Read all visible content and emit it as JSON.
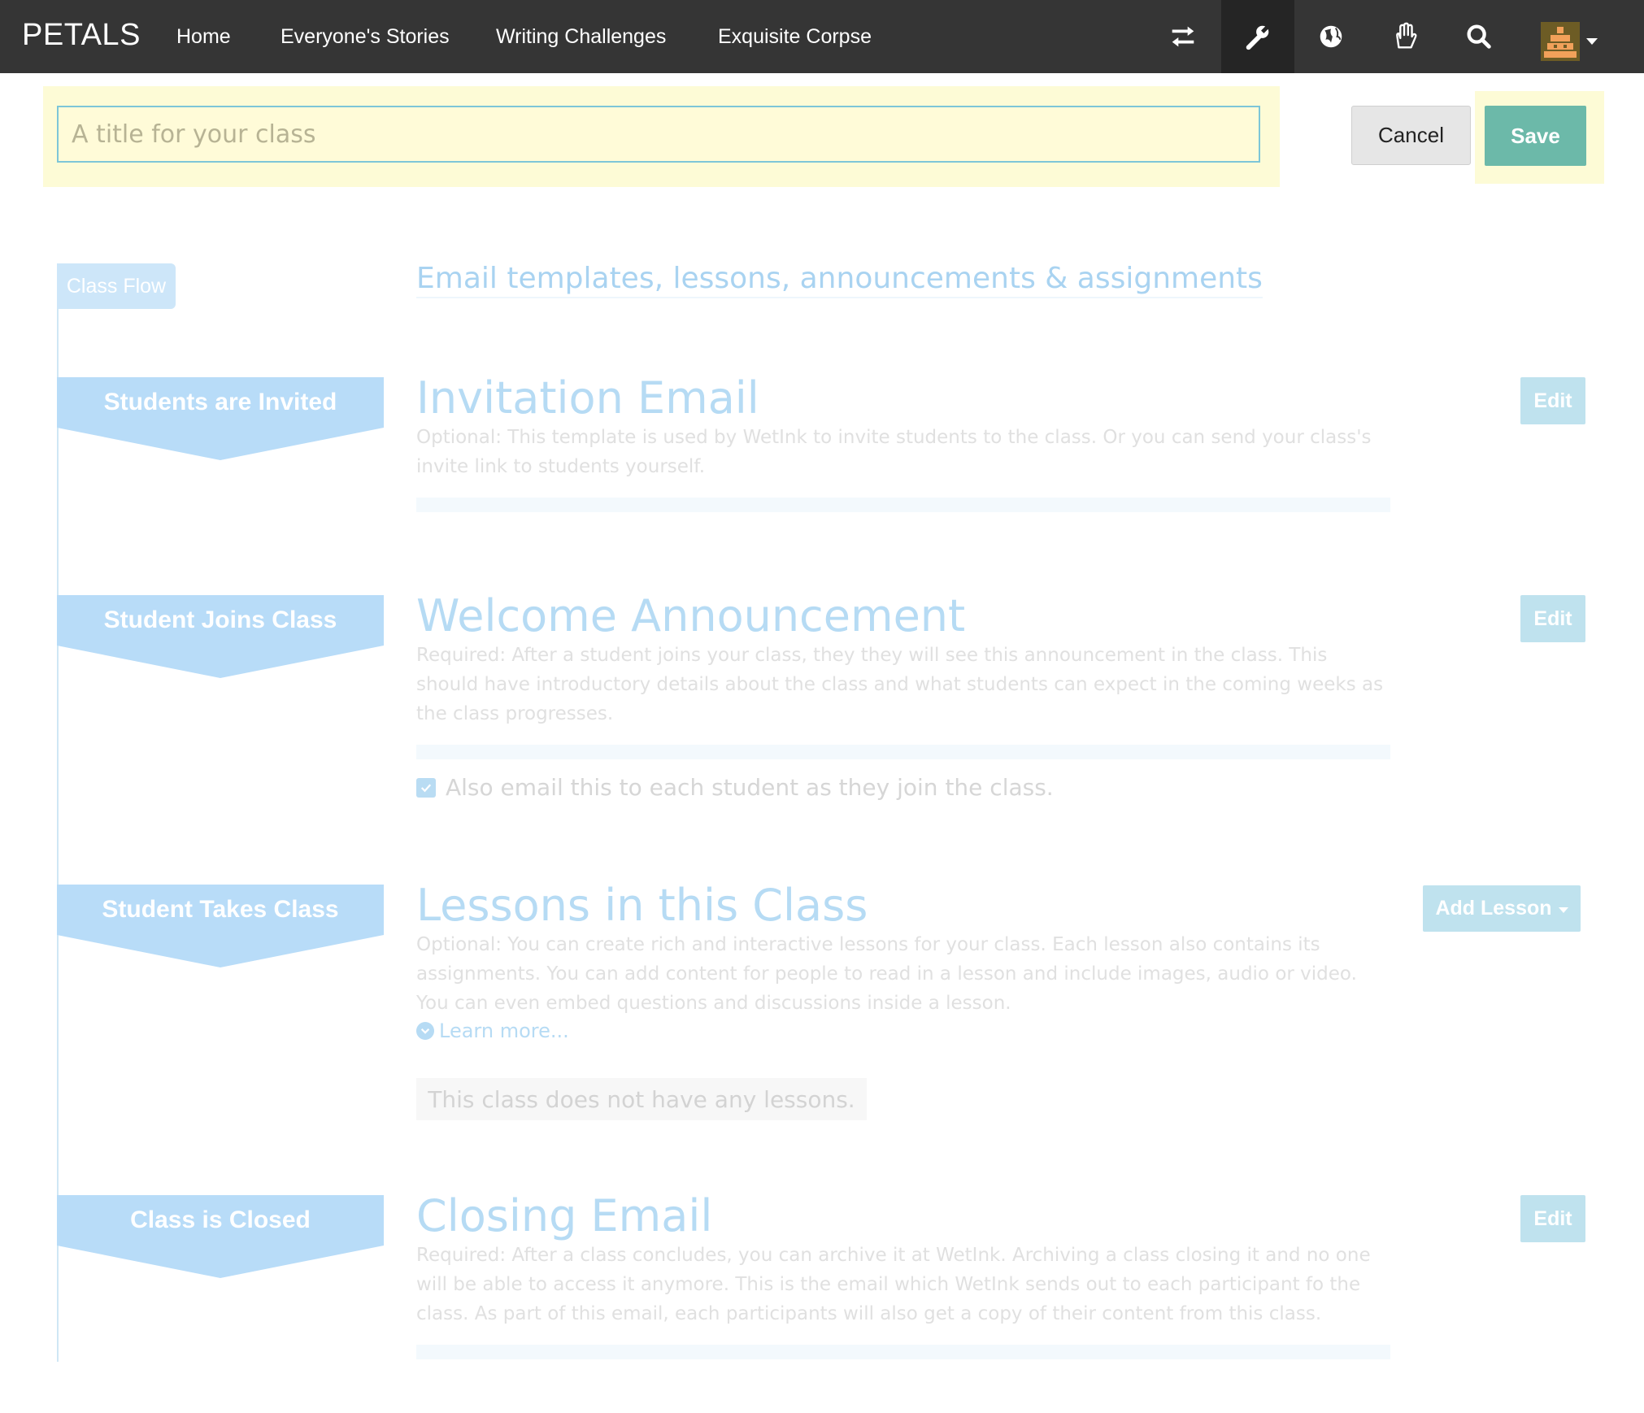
{
  "navbar": {
    "brand": "PETALS",
    "links": [
      "Home",
      "Everyone's Stories",
      "Writing Challenges",
      "Exquisite Corpse"
    ],
    "icons": [
      "transfer-icon",
      "wrench-icon",
      "globe-icon",
      "hand-icon",
      "search-icon",
      "avatar"
    ]
  },
  "title_bar": {
    "placeholder": "A title for your class",
    "value": "",
    "cancel_label": "Cancel",
    "save_label": "Save"
  },
  "flow": {
    "tab_label": "Class Flow",
    "subtitle": "Email templates, lessons, announcements & assignments",
    "stages": [
      {
        "label": "Students are Invited"
      },
      {
        "label": "Student Joins Class"
      },
      {
        "label": "Student Takes Class"
      },
      {
        "label": "Class is Closed"
      }
    ]
  },
  "sections": {
    "invitation": {
      "title": "Invitation Email",
      "description": "Optional: This template is used by WetInk to invite students to the class. Or you can send your class's invite link to students yourself.",
      "button": "Edit"
    },
    "welcome": {
      "title": "Welcome Announcement",
      "description": "Required: After a student joins your class, they they will see this announcement in the class. This should have introductory details about the class and what students can expect in the coming weeks as the class progresses.",
      "button": "Edit",
      "checkbox_label": "Also email this to each student as they join the class.",
      "checkbox_checked": true
    },
    "lessons": {
      "title": "Lessons in this Class",
      "description": "Optional: You can create rich and interactive lessons for your class. Each lesson also contains its assignments. You can add content for people to read in a lesson and include images, audio or video. You can even embed questions and discussions inside a lesson.",
      "learn_more": "Learn more...",
      "button": "Add Lesson",
      "empty_text": "This class does not have any lessons."
    },
    "closing": {
      "title": "Closing Email",
      "description": "Required: After a class concludes, you can archive it at WetInk. Archiving a class closing it and no one will be able to access it anymore. This is the email which WetInk sends out to each participant fo the class. As part of this email, each participants will also get a copy of their content from this class.",
      "button": "Edit"
    }
  },
  "colors": {
    "navbar_bg": "#353535",
    "highlight": "#fdfbd6",
    "save_button": "#6cb9a9",
    "stage_fill": "#b8dcf8",
    "section_title": "#b6dbf4",
    "edit_button": "#bfe2ee"
  }
}
